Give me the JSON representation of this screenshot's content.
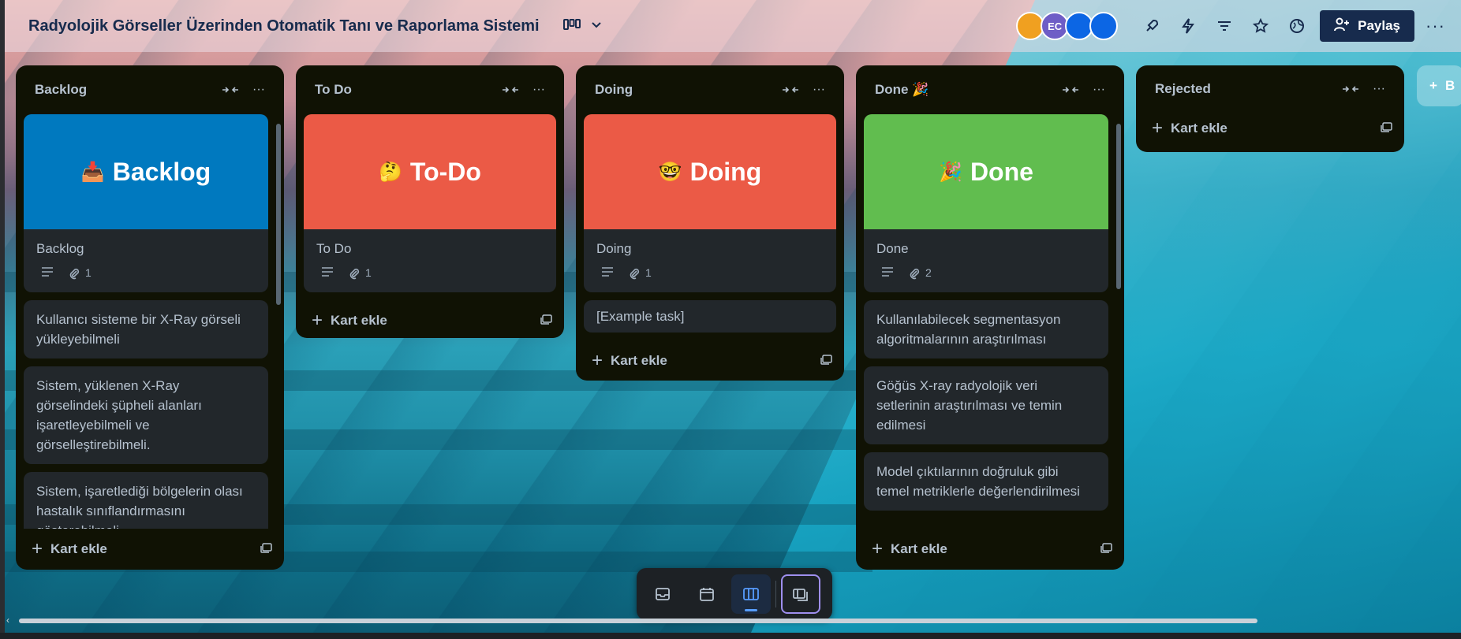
{
  "header": {
    "board_title": "Radyolojik Görseller Üzerinden Otomatik Tanı ve Raporlama Sistemi",
    "avatars": [
      "",
      "EC",
      "",
      ""
    ],
    "share_label": "Paylaş"
  },
  "lists": [
    {
      "title": "Backlog",
      "cards": [
        {
          "cover_text": "Backlog",
          "cover_emoji": "📥",
          "cover_color": "#0079bf",
          "title": "Backlog",
          "attachments": "1"
        },
        {
          "title": "Kullanıcı sisteme bir X-Ray görseli yükleyebilmeli"
        },
        {
          "title": "Sistem, yüklenen X-Ray görselindeki şüpheli alanları işaretleyebilmeli ve görselleştirebilmeli."
        },
        {
          "title": "Sistem, işaretlediği bölgelerin olası hastalık sınıflandırmasını gösterebilmeli."
        }
      ],
      "add_label": "Kart ekle"
    },
    {
      "title": "To Do",
      "cards": [
        {
          "cover_text": "To-Do",
          "cover_emoji": "🤔",
          "cover_color": "#eb5a46",
          "title": "To Do",
          "attachments": "1"
        }
      ],
      "add_label": "Kart ekle"
    },
    {
      "title": "Doing",
      "cards": [
        {
          "cover_text": "Doing",
          "cover_emoji": "🤓",
          "cover_color": "#eb5a46",
          "title": "Doing",
          "attachments": "1"
        },
        {
          "title": "[Example task]"
        }
      ],
      "add_label": "Kart ekle"
    },
    {
      "title": "Done 🎉",
      "cards": [
        {
          "cover_text": "Done",
          "cover_emoji": "🎉",
          "cover_color": "#61bd4f",
          "title": "Done",
          "attachments": "2"
        },
        {
          "title": "Kullanılabilecek segmentasyon algoritmalarının araştırılması"
        },
        {
          "title": "Göğüs X-ray radyolojik veri setlerinin araştırılması ve temin edilmesi"
        },
        {
          "title": "Model çıktılarının doğruluk gibi temel metriklerle değerlendirilmesi"
        }
      ],
      "add_label": "Kart ekle"
    },
    {
      "title": "Rejected",
      "cards": [],
      "add_label": "Kart ekle"
    }
  ],
  "add_list_label": "B"
}
